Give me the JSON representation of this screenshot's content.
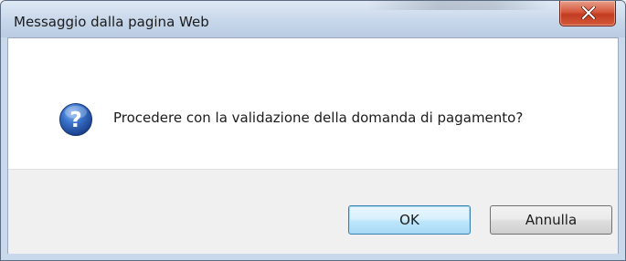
{
  "dialog": {
    "title": "Messaggio dalla pagina Web",
    "message": "Procedere con la validazione della domanda di pagamento?",
    "icon": "question-icon",
    "buttons": {
      "ok_label": "OK",
      "cancel_label": "Annulla"
    },
    "close_icon": "close-icon"
  },
  "colors": {
    "titlebar": "#c7d7ea",
    "close_button": "#c23b20",
    "question_icon": "#2a5fb3",
    "button_area": "#f0f0f0",
    "ok_focus_border": "#3c7fb1"
  }
}
